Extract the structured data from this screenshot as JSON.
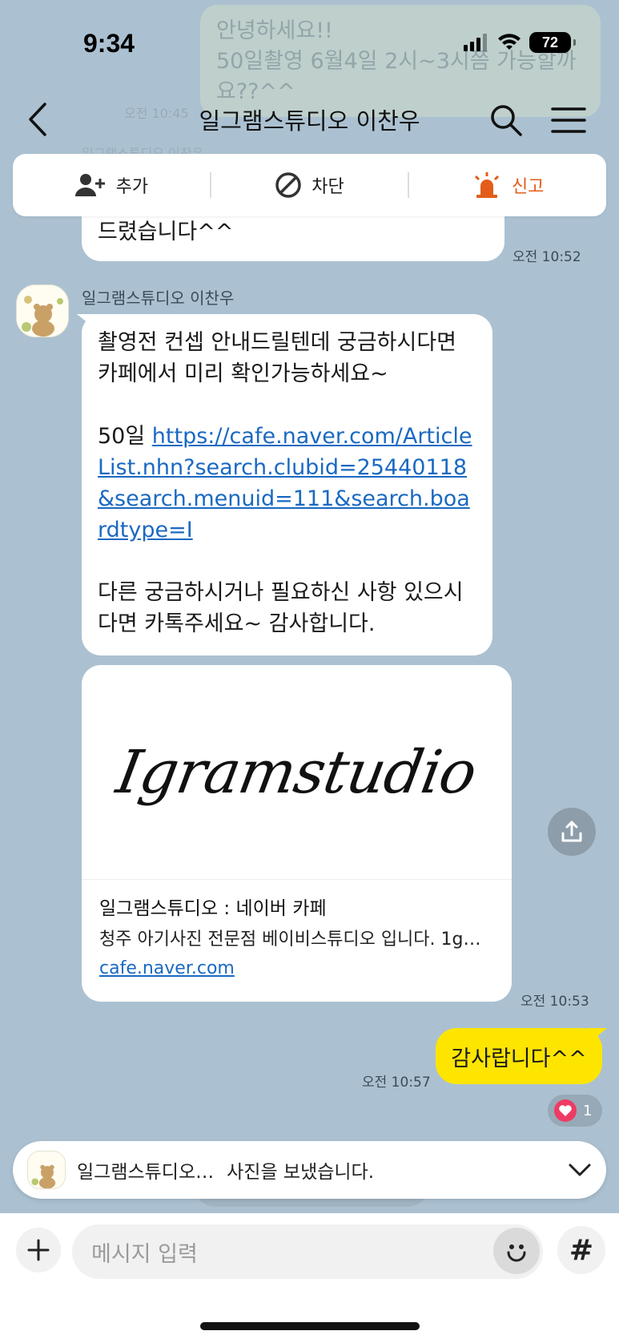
{
  "status": {
    "time": "9:34",
    "battery": "72"
  },
  "background_message": {
    "lines": [
      "안녕하세요!!",
      "50일촬영 6월4일 2시~3시쯤 가능할까",
      "요??^^"
    ],
    "time": "오전 10:45",
    "name": "일그램스튜디오 이찬우"
  },
  "header": {
    "title": "일그램스튜디오  이찬우"
  },
  "action_bar": {
    "add_label": "추가",
    "block_label": "차단",
    "report_label": "신고"
  },
  "messages": {
    "partial_text": "드렸습니다^^",
    "partial_time": "오전 10:52",
    "sender_name": "일그램스튜디오  이찬우",
    "line1": "촬영전 컨셉 안내드릴텐데 궁금하시다면",
    "line2": "카페에서 미리 확인가능하세요~",
    "link_prefix": "50일 ",
    "link_url": "https://cafe.naver.com/ArticleList.nhn?search.clubid=25440118&search.menuid=111&search.boardtype=I",
    "line3": "다른 궁금하시거나 필요하신 사항 있으시",
    "line4": "다면 카톡주세요~ 감사합니다.",
    "card": {
      "logo_text": "Igramstudio",
      "title": "일그램스튜디오 : 네이버 카페",
      "description": "청주 아기사진 전문점 베이비스튜디오 입니다. 1g…",
      "url": "cafe.naver.com"
    },
    "card_time": "오전 10:53",
    "my_message": "감사랍니다^^",
    "my_time": "오전 10:57",
    "reaction_count": "1"
  },
  "notification": {
    "name": "일그램스튜디오…",
    "message": "사진을 보냈습니다."
  },
  "input": {
    "placeholder": "메시지 입력",
    "hash_label": "#"
  }
}
